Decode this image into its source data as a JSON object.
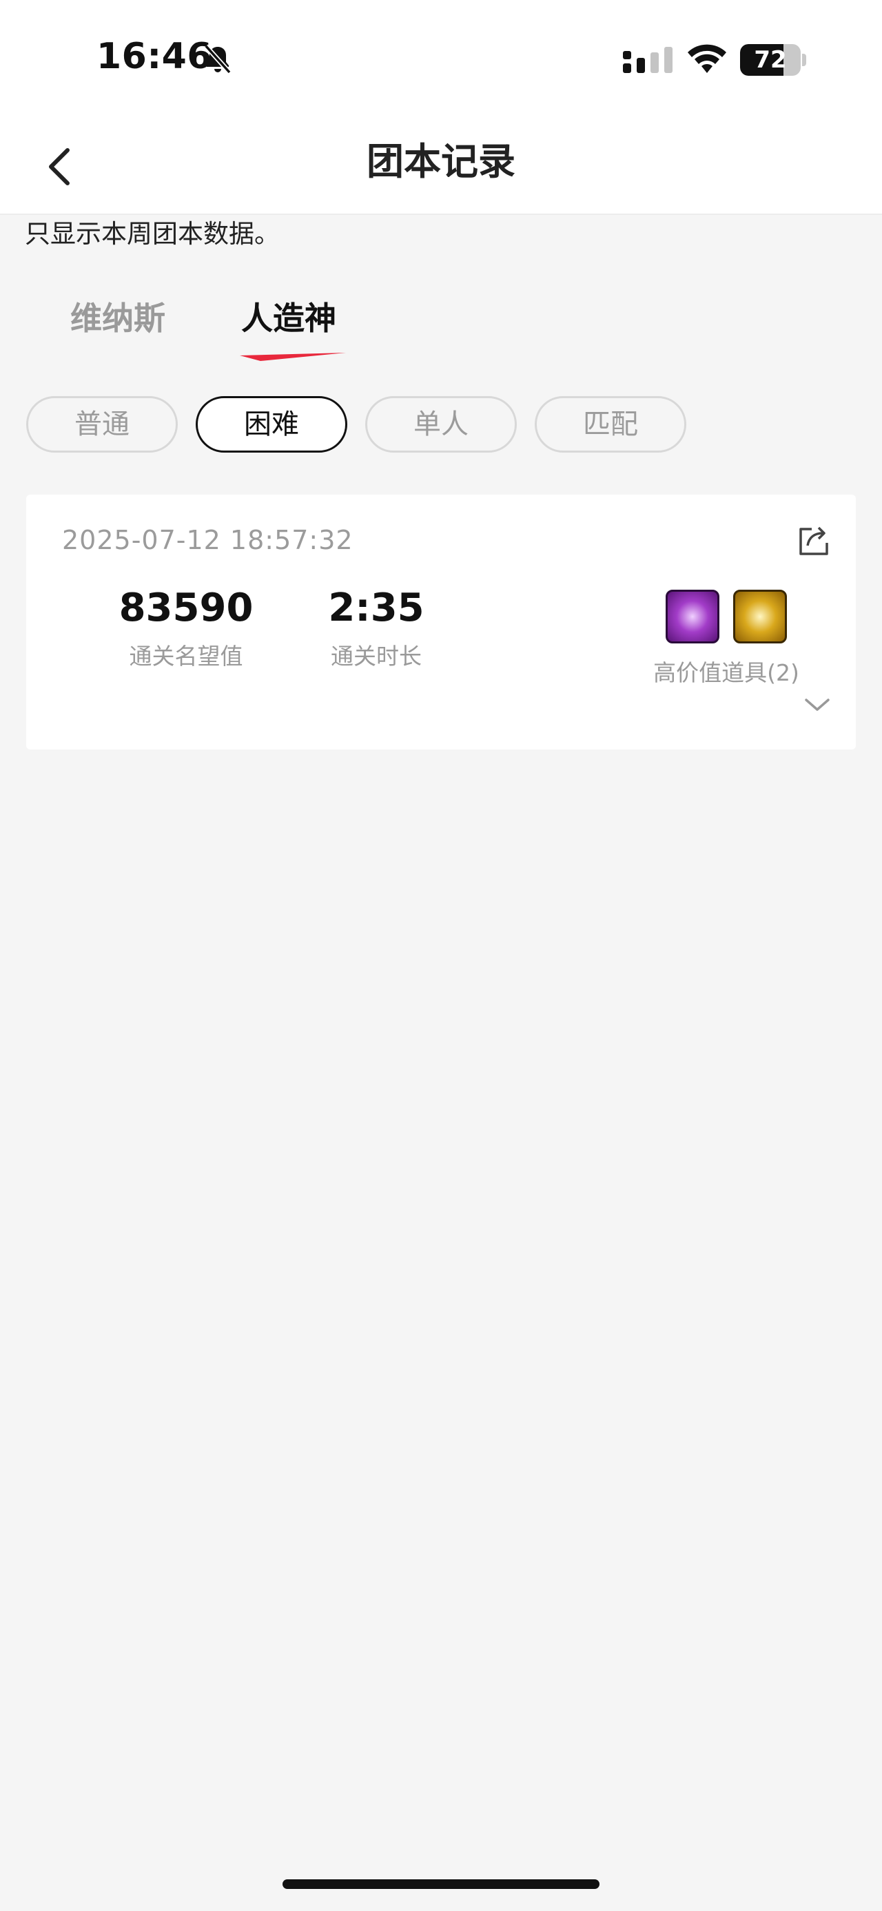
{
  "status_bar": {
    "time": "16:46",
    "battery_text": "72",
    "battery_level": 0.72,
    "icons": [
      "bell-slash-icon",
      "cellular-signal-icon",
      "wifi-icon",
      "battery-icon"
    ]
  },
  "nav": {
    "title": "团本记录",
    "back_icon": "chevron-left-icon"
  },
  "notice": "只显示本周团本数据。",
  "tabs": [
    {
      "label": "维纳斯",
      "active": false
    },
    {
      "label": "人造神",
      "active": true
    }
  ],
  "difficulty_filters": [
    {
      "label": "普通",
      "active": false
    },
    {
      "label": "困难",
      "active": true
    },
    {
      "label": "单人",
      "active": false
    },
    {
      "label": "匹配",
      "active": false
    }
  ],
  "record": {
    "date": "2025-07-12 18:57:32",
    "stats": [
      {
        "value": "83590",
        "label": "通关名望值"
      },
      {
        "value": "2:35",
        "label": "通关时长"
      }
    ],
    "items_label": "高价值道具(2)",
    "item_icons": [
      "purple-box-icon",
      "gold-box-icon"
    ],
    "share_icon": "share-icon",
    "expand_icon": "chevron-down-icon"
  },
  "colors": {
    "accent": "#e8283c",
    "background": "#f5f5f5",
    "card": "#ffffff",
    "muted_text": "#9b9b9b"
  }
}
